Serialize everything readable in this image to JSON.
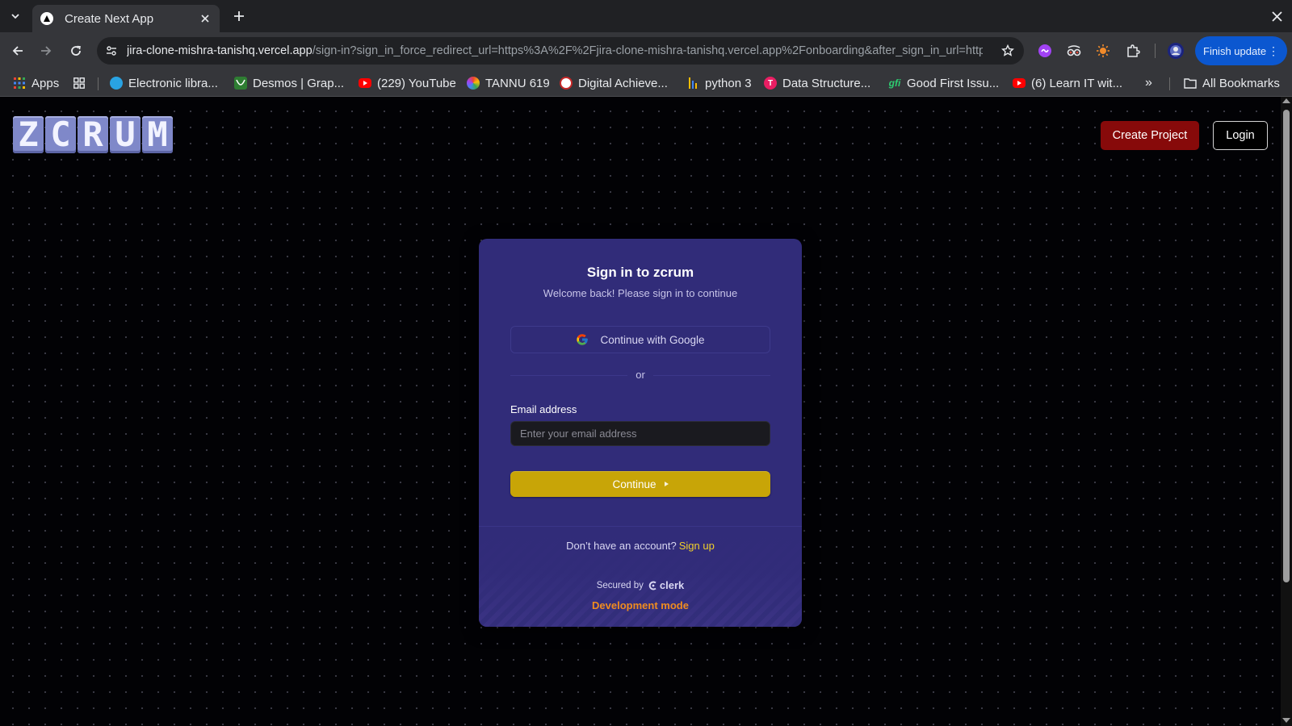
{
  "browser": {
    "tab_title": "Create Next App",
    "url_host": "jira-clone-mishra-tanishq.vercel.app",
    "url_rest": "/sign-in?sign_in_force_redirect_url=https%3A%2F%2Fjira-clone-mishra-tanishq.vercel.app%2Fonboarding&after_sign_in_url=https...",
    "finish_update": "Finish update",
    "bookmarks": [
      {
        "label": "Apps"
      },
      {
        "label": "Electronic libra..."
      },
      {
        "label": "Desmos | Grap..."
      },
      {
        "label": "(229) YouTube"
      },
      {
        "label": "TANNU 619"
      },
      {
        "label": "Digital Achieve..."
      },
      {
        "label": "python 3"
      },
      {
        "label": "Data Structure..."
      },
      {
        "label": "Good First Issu..."
      },
      {
        "label": "(6) Learn IT wit..."
      }
    ],
    "all_bookmarks": "All Bookmarks"
  },
  "header": {
    "logo_letters": [
      "Z",
      "C",
      "R",
      "U",
      "M"
    ],
    "create_project": "Create Project",
    "login": "Login"
  },
  "signin": {
    "title": "Sign in to zcrum",
    "subtitle": "Welcome back! Please sign in to continue",
    "google_button": "Continue with Google",
    "divider": "or",
    "email_label": "Email address",
    "email_placeholder": "Enter your email address",
    "email_value": "",
    "continue_button": "Continue",
    "no_account": "Don’t have an account?",
    "sign_up": "Sign up",
    "secured_by": "Secured by",
    "clerk": "clerk",
    "dev_mode": "Development mode"
  },
  "colors": {
    "card_bg": "#312c79",
    "accent_yellow": "#c8a507",
    "create_project_bg": "#870a0a",
    "dev_mode": "#f08c1f",
    "logo": "#7f88c9"
  },
  "icons": [
    "chevron-down-icon",
    "nextjs-favicon-icon",
    "close-icon",
    "plus-icon",
    "back-icon",
    "forward-icon",
    "reload-icon",
    "site-info-icon",
    "star-icon",
    "extensions-icon",
    "profile-icon",
    "more-vert-icon",
    "google-icon",
    "clerk-icon",
    "folder-icon"
  ]
}
